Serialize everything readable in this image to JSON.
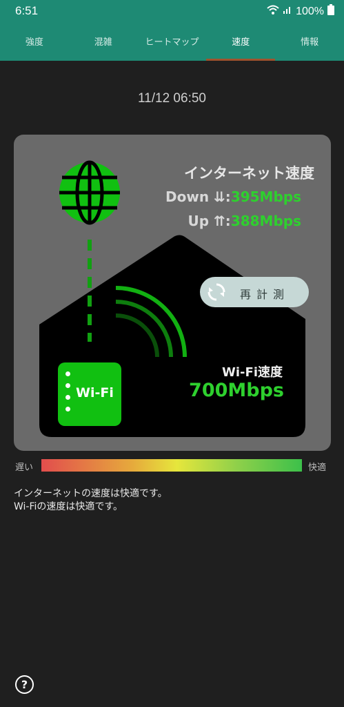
{
  "status_bar": {
    "time": "6:51",
    "battery": "100%"
  },
  "tabs": [
    {
      "label": "強度"
    },
    {
      "label": "混雑"
    },
    {
      "label": "ヒートマップ"
    },
    {
      "label": "速度",
      "active": true
    },
    {
      "label": "情報"
    }
  ],
  "timestamp": "11/12 06:50",
  "internet": {
    "title": "インターネット速度",
    "down_label": "Down ⇊:",
    "down_value": "395Mbps",
    "up_label": "Up ⇈:",
    "up_value": "388Mbps"
  },
  "remeasure_label": "再計測",
  "wifi": {
    "icon_label": "Wi-Fi",
    "speed_label": "Wi-Fi速度",
    "speed_value": "700Mbps"
  },
  "scale": {
    "slow": "遅い",
    "fast": "快適"
  },
  "messages": [
    "インターネットの速度は快適です。",
    "Wi-Fiの速度は快適です。"
  ],
  "help_label": "?",
  "colors": {
    "accent": "#1e8a74",
    "speed_green": "#2ed02e",
    "wifi_green": "#11c011"
  }
}
